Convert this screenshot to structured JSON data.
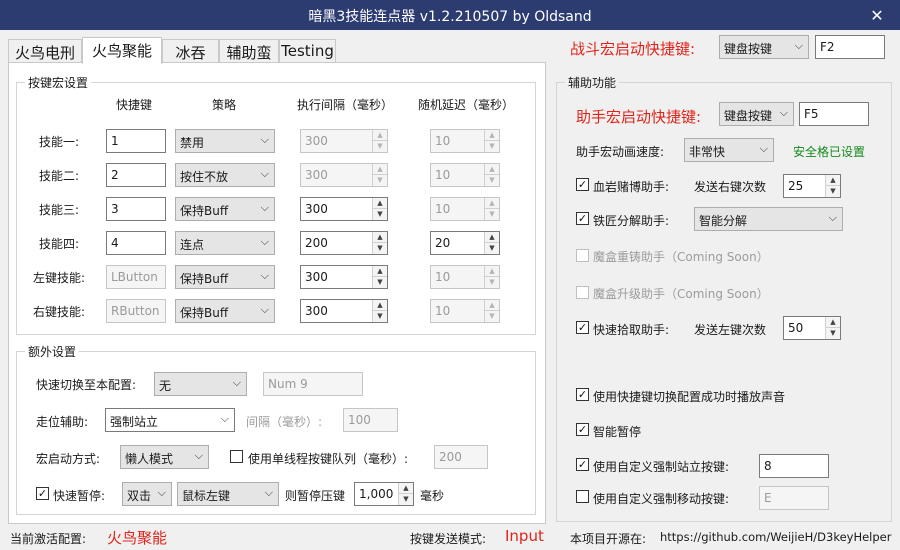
{
  "window": {
    "title": "暗黑3技能连点器 v1.2.210507   by Oldsand",
    "close_glyph": "✕"
  },
  "tabs": [
    {
      "label": "火鸟电刑"
    },
    {
      "label": "火鸟聚能"
    },
    {
      "label": "冰吞"
    },
    {
      "label": "辅助蛮"
    },
    {
      "label": "Testing"
    }
  ],
  "battle_hotkey": {
    "label": "战斗宏启动快捷键:",
    "type": "键盘按键",
    "key": "F2"
  },
  "macro": {
    "group_label": "按键宏设置",
    "headers": {
      "hotkey": "快捷键",
      "strategy": "策略",
      "interval": "执行间隔（毫秒）",
      "delay": "随机延迟（毫秒）"
    },
    "rows": [
      {
        "label": "技能一:",
        "key": "1",
        "strategy": "禁用",
        "interval": "300",
        "delay": "10"
      },
      {
        "label": "技能二:",
        "key": "2",
        "strategy": "按住不放",
        "interval": "300",
        "delay": "10"
      },
      {
        "label": "技能三:",
        "key": "3",
        "strategy": "保持Buff",
        "interval": "300",
        "delay": "10"
      },
      {
        "label": "技能四:",
        "key": "4",
        "strategy": "连点",
        "interval": "200",
        "delay": "20"
      },
      {
        "label": "左键技能:",
        "key": "LButton",
        "strategy": "保持Buff",
        "interval": "300",
        "delay": "10"
      },
      {
        "label": "右键技能:",
        "key": "RButton",
        "strategy": "保持Buff",
        "interval": "300",
        "delay": "10"
      }
    ]
  },
  "extra": {
    "group_label": "额外设置",
    "quick_switch": {
      "label": "快速切换至本配置:",
      "value": "无",
      "hotkey": "Num 9"
    },
    "move_assist": {
      "label": "走位辅助:",
      "value": "强制站立",
      "interval_label": "间隔（毫秒）:",
      "interval": "100"
    },
    "start_mode": {
      "label": "宏启动方式:",
      "value": "懒人模式",
      "single_thread_label": "使用单线程按键队列（毫秒）:",
      "single_thread_value": "200"
    },
    "quick_pause": {
      "label": "快速暂停:",
      "mode": "双击",
      "button": "鼠标左键",
      "suffix_label": "则暂停压键",
      "value": "1,000",
      "unit": "毫秒"
    }
  },
  "assist": {
    "group_label": "辅助功能",
    "hotkey": {
      "label": "助手宏启动快捷键:",
      "type": "键盘按键",
      "key": "F5"
    },
    "anim_speed": {
      "label": "助手宏动画速度:",
      "value": "非常快",
      "status": "安全格已设置"
    },
    "gamble": {
      "label": "血岩赌博助手:",
      "sub_label": "发送右键次数",
      "value": "25"
    },
    "salvage": {
      "label": "铁匠分解助手:",
      "value": "智能分解"
    },
    "reforge": {
      "label": "魔盒重铸助手（Coming Soon）"
    },
    "upgrade": {
      "label": "魔盒升级助手（Coming Soon）"
    },
    "pickup": {
      "label": "快速拾取助手:",
      "sub_label": "发送左键次数",
      "value": "50"
    },
    "sound": {
      "label": "使用快捷键切换配置成功时播放声音"
    },
    "smart_pause": {
      "label": "智能暂停"
    },
    "custom_stand": {
      "label": "使用自定义强制站立按键:",
      "value": "8"
    },
    "custom_move": {
      "label": "使用自定义强制移动按键:",
      "value": "E"
    }
  },
  "status": {
    "active_label": "当前激活配置:",
    "active_value": "火鸟聚能",
    "send_mode_label": "按键发送模式:",
    "send_mode_value": "Input",
    "opensource_label": "本项目开源在:",
    "opensource_link": "https://github.com/WeijieH/D3keyHelper"
  },
  "glyphs": {
    "check": "✓",
    "chevron": "⌵",
    "up": "▲",
    "down": "▼"
  }
}
